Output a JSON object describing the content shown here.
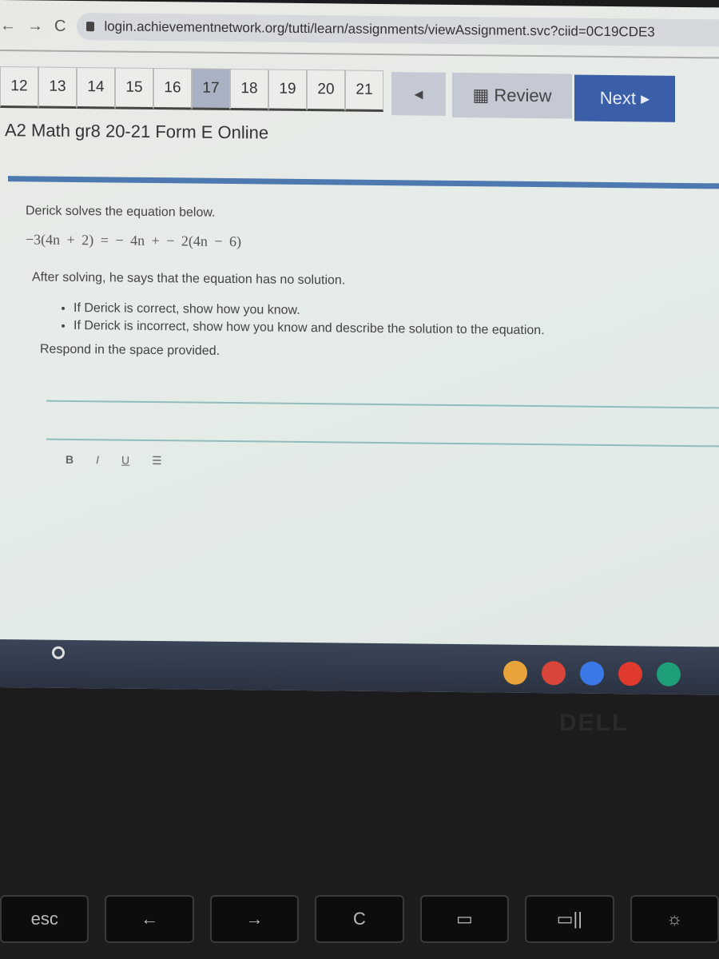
{
  "browser": {
    "url": "login.achievementnetwork.org/tutti/learn/assignments/viewAssignment.svc?ciid=0C19CDE3",
    "back_icon": "arrow-left",
    "forward_icon": "arrow-right",
    "reload_icon": "reload"
  },
  "question_nav": {
    "items": [
      "12",
      "13",
      "14",
      "15",
      "16",
      "17",
      "18",
      "19",
      "20",
      "21"
    ],
    "active": "17",
    "prev_icon": "triangle-left",
    "review_label": "Review",
    "next_label": "Next ▸"
  },
  "assessment_title": "A2 Math gr8 20-21 Form E Online",
  "question": {
    "intro": "Derick solves the equation below.",
    "equation": "−3(4n + 2) = − 4n + − 2(4n − 6)",
    "claim": "After solving, he says that the equation has no solution.",
    "bullets": [
      "If Derick is correct, show how you know.",
      "If Derick is incorrect, show how you know and describe the solution to the equation."
    ],
    "instruction": "Respond in the space provided."
  },
  "editor": {
    "toolbar": [
      "B",
      "I",
      "U",
      "☰"
    ],
    "value": ""
  },
  "shelf": {
    "apps": [
      "chrome",
      "gmail",
      "docs",
      "youtube",
      "meet"
    ],
    "colors": {
      "chrome": "#e8a33a",
      "gmail": "#d9453b",
      "docs": "#3b78e7",
      "youtube": "#e03a2e",
      "meet": "#1f9e7a"
    }
  },
  "laptop": {
    "brand": "DELL",
    "keys": [
      "esc",
      "←",
      "→",
      "C",
      "▭",
      "▭||",
      "☼"
    ]
  }
}
